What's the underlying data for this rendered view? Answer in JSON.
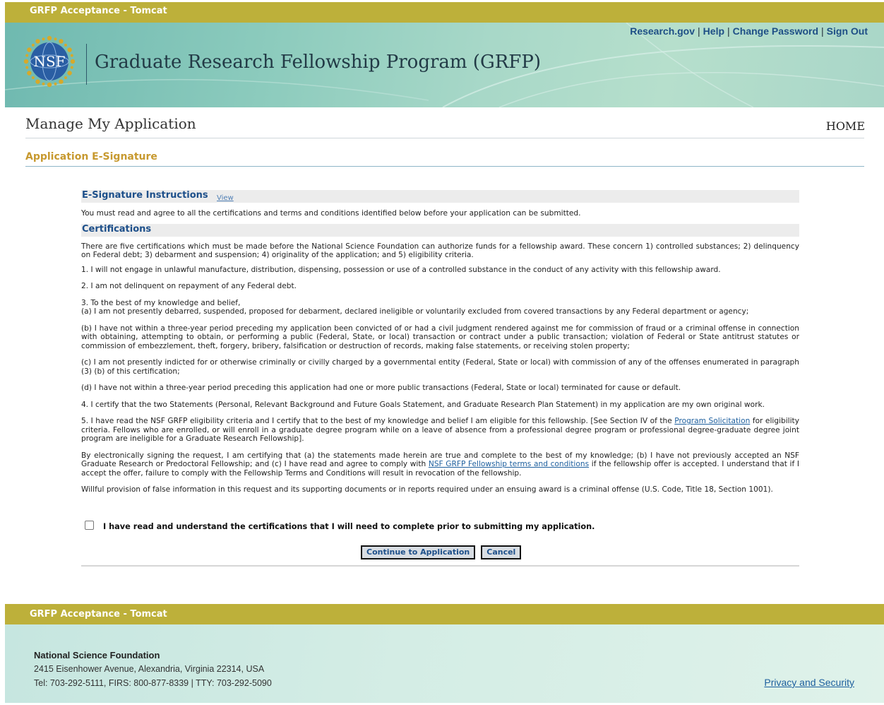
{
  "env_banner": "GRFP Acceptance - Tomcat",
  "top_links": {
    "research": "Research.gov",
    "help": "Help",
    "change_password": "Change Password",
    "sign_out": "Sign Out"
  },
  "logo_text": "NSF",
  "site_title": "Graduate Research Fellowship Program (GRFP)",
  "page_title": "Manage My Application",
  "home_link": "HOME",
  "section_title": "Application E-Signature",
  "instructions": {
    "heading": "E-Signature Instructions",
    "view_link": "View",
    "text": "You must read and agree to all the certifications and terms and conditions identified below before your application can be submitted."
  },
  "certifications": {
    "heading": "Certifications",
    "intro": "There are five certifications which must be made before the National Science Foundation can authorize funds for a fellowship award. These concern 1) controlled substances; 2) delinquency on Federal debt; 3) debarment and suspension; 4) originality of the application; and 5) eligibility criteria.",
    "c1": "1. I will not engage in unlawful manufacture, distribution, dispensing, possession or use of a controlled substance in the conduct of any activity with this fellowship award.",
    "c2": "2. I am not delinquent on repayment of any Federal debt.",
    "c3_intro": "3. To the best of my knowledge and belief,",
    "c3a": "(a) I am not presently debarred, suspended, proposed for debarment, declared ineligible or voluntarily excluded from covered transactions by any Federal department or agency;",
    "c3b": "(b) I have not within a three-year period preceding my application been convicted of or had a civil judgment rendered against me for commission of fraud or a criminal offense in connection with obtaining, attempting to obtain, or performing a public (Federal, State, or local) transaction or contract under a public transaction; violation of Federal or State antitrust statutes or commission of embezzlement, theft, forgery, bribery, falsification or destruction of records, making false statements, or receiving stolen property;",
    "c3c": "(c) I am not presently indicted for or otherwise criminally or civilly charged by a governmental entity (Federal, State or local) with commission of any of the offenses enumerated in paragraph (3) (b) of this certification;",
    "c3d": "(d) I have not within a three-year period preceding this application had one or more public transactions (Federal, State or local) terminated for cause or default.",
    "c4": "4. I certify that the two Statements (Personal, Relevant Background and Future Goals Statement, and Graduate Research Plan Statement) in my application are my own original work.",
    "c5_pre": "5. I have read the NSF GRFP eligibility criteria and I certify that to the best of my knowledge and belief I am eligible for this fellowship. [See Section IV of the ",
    "c5_link": "Program Solicitation",
    "c5_post": " for eligibility criteria. Fellows who are enrolled, or will enroll in a graduate degree program while on a leave of absence from a professional degree program or professional degree-graduate degree joint program are ineligible for a Graduate Research Fellowship].",
    "sign_pre": "By electronically signing the request, I am certifying that (a) the statements made herein are true and complete to the best of my knowledge; (b) I have not previously accepted an NSF Graduate Research or Predoctoral Fellowship; and (c) I have read and agree to comply with ",
    "sign_link": "NSF GRFP Fellowship terms and conditions",
    "sign_post": " if the fellowship offer is accepted. I understand that if I accept the offer, failure to comply with the Fellowship Terms and Conditions will result in revocation of the fellowship.",
    "willful": "Willful provision of false information in this request and its supporting documents or in reports required under an ensuing award is a criminal offense (U.S. Code, Title 18, Section 1001)."
  },
  "acknowledge": {
    "label": "I have read and understand the certifications that I will need to complete prior to submitting my application.",
    "checked": false
  },
  "buttons": {
    "continue": "Continue to Application",
    "cancel": "Cancel"
  },
  "footer": {
    "org": "National Science Foundation",
    "address": "2415 Eisenhower Avenue, Alexandria, Virginia 22314, USA",
    "tel": "Tel: 703-292-5111, FIRS: 800-877-8339 | TTY: 703-292-5090",
    "privacy": "Privacy and Security"
  }
}
